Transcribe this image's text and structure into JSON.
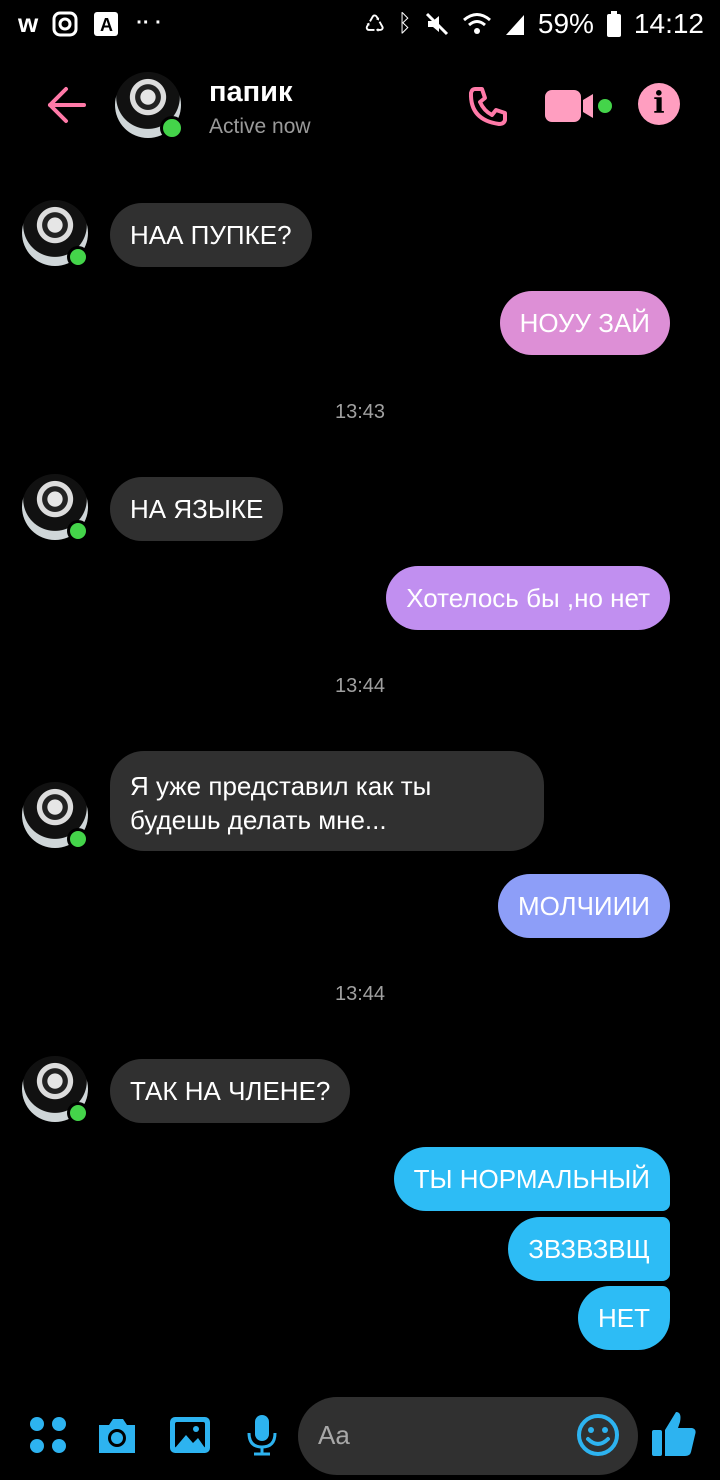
{
  "status_bar": {
    "time": "14:12",
    "battery": "59%"
  },
  "header": {
    "contact_name": "папик",
    "status": "Active now"
  },
  "messages": [
    {
      "side": "in",
      "text": "НАА ПУПКЕ?"
    },
    {
      "side": "out",
      "text": "НОУУ ЗАЙ",
      "color": "#dd8fd6"
    },
    {
      "time": "13:43"
    },
    {
      "side": "in",
      "text": "НА ЯЗЫКЕ"
    },
    {
      "side": "out",
      "text": "Хотелось бы ,но нет",
      "color": "#c18ff0"
    },
    {
      "time": "13:44"
    },
    {
      "side": "in",
      "lines": [
        "Я уже представил как ты",
        "будешь делать мне..."
      ]
    },
    {
      "side": "out",
      "text": "МОЛЧИИИ",
      "color": "#8d9ef8"
    },
    {
      "time": "13:44"
    },
    {
      "side": "in",
      "text": "ТАК НА ЧЛЕНЕ?"
    },
    {
      "side": "out",
      "text": "ТЫ НОРМАЛЬНЫЙ",
      "color": "#2dbcf5"
    },
    {
      "side": "out",
      "text": "ЗВЗВЗВЩ",
      "color": "#2dbcf5"
    },
    {
      "side": "out",
      "text": "НЕТ",
      "color": "#2dbcf5"
    }
  ],
  "composer": {
    "placeholder": "Aa"
  },
  "colors": {
    "accent_pink": "#ff7aa8",
    "accent_blue": "#2db3f0",
    "online_green": "#44d44a",
    "incoming_bubble": "#303030"
  },
  "icons": {
    "status_left": [
      "w-logo-icon",
      "instagram-icon",
      "translate-icon"
    ],
    "status_right": [
      "recycle-icon",
      "bluetooth-icon",
      "mute-icon",
      "wifi-icon",
      "signal-icon",
      "battery-icon"
    ],
    "header": [
      "back-arrow-icon",
      "phone-icon",
      "video-icon",
      "info-icon"
    ],
    "toolbar": [
      "apps-icon",
      "camera-icon",
      "image-icon",
      "mic-icon",
      "emoji-icon",
      "thumbs-up-icon"
    ]
  }
}
